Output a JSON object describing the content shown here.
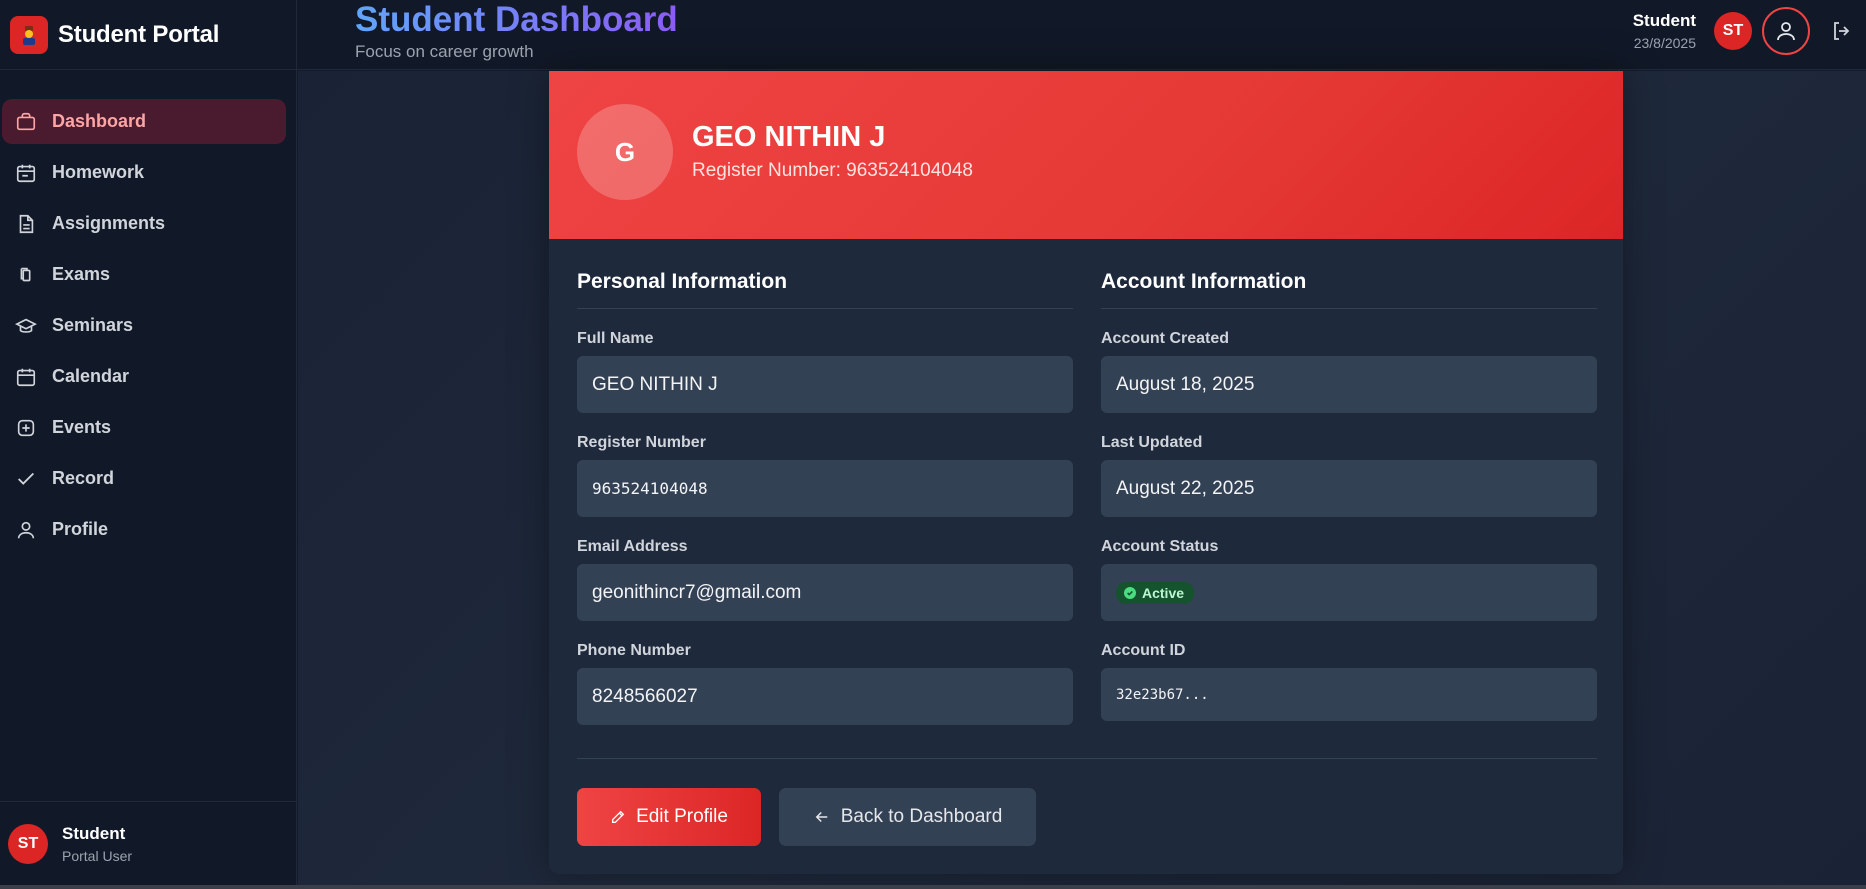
{
  "sidebar": {
    "brand": "Student Portal",
    "items": [
      {
        "label": "Dashboard",
        "icon": "briefcase-icon",
        "active": true
      },
      {
        "label": "Homework",
        "icon": "calendar-note-icon"
      },
      {
        "label": "Assignments",
        "icon": "document-icon"
      },
      {
        "label": "Exams",
        "icon": "copy-icon"
      },
      {
        "label": "Seminars",
        "icon": "graduation-cap-icon"
      },
      {
        "label": "Calendar",
        "icon": "calendar-icon"
      },
      {
        "label": "Events",
        "icon": "plus-square-icon"
      },
      {
        "label": "Record",
        "icon": "check-icon"
      },
      {
        "label": "Profile",
        "icon": "user-icon"
      }
    ],
    "user": {
      "initials": "ST",
      "name": "Student",
      "role": "Portal User"
    }
  },
  "header": {
    "title": "Student Dashboard",
    "subtitle": "Focus on career growth",
    "user_name": "Student",
    "date": "23/8/2025",
    "initials": "ST"
  },
  "profile": {
    "initial": "G",
    "name": "GEO NITHIN J",
    "register_line": "Register Number: 963524104048",
    "personal": {
      "title": "Personal Information",
      "full_name_label": "Full Name",
      "full_name": "GEO NITHIN J",
      "register_label": "Register Number",
      "register": "963524104048",
      "email_label": "Email Address",
      "email": "geonithincr7@gmail.com",
      "phone_label": "Phone Number",
      "phone": "8248566027"
    },
    "account": {
      "title": "Account Information",
      "created_label": "Account Created",
      "created": "August 18, 2025",
      "updated_label": "Last Updated",
      "updated": "August 22, 2025",
      "status_label": "Account Status",
      "status": "Active",
      "id_label": "Account ID",
      "id": "32e23b67..."
    },
    "actions": {
      "edit": "Edit Profile",
      "back": "Back to Dashboard"
    }
  }
}
